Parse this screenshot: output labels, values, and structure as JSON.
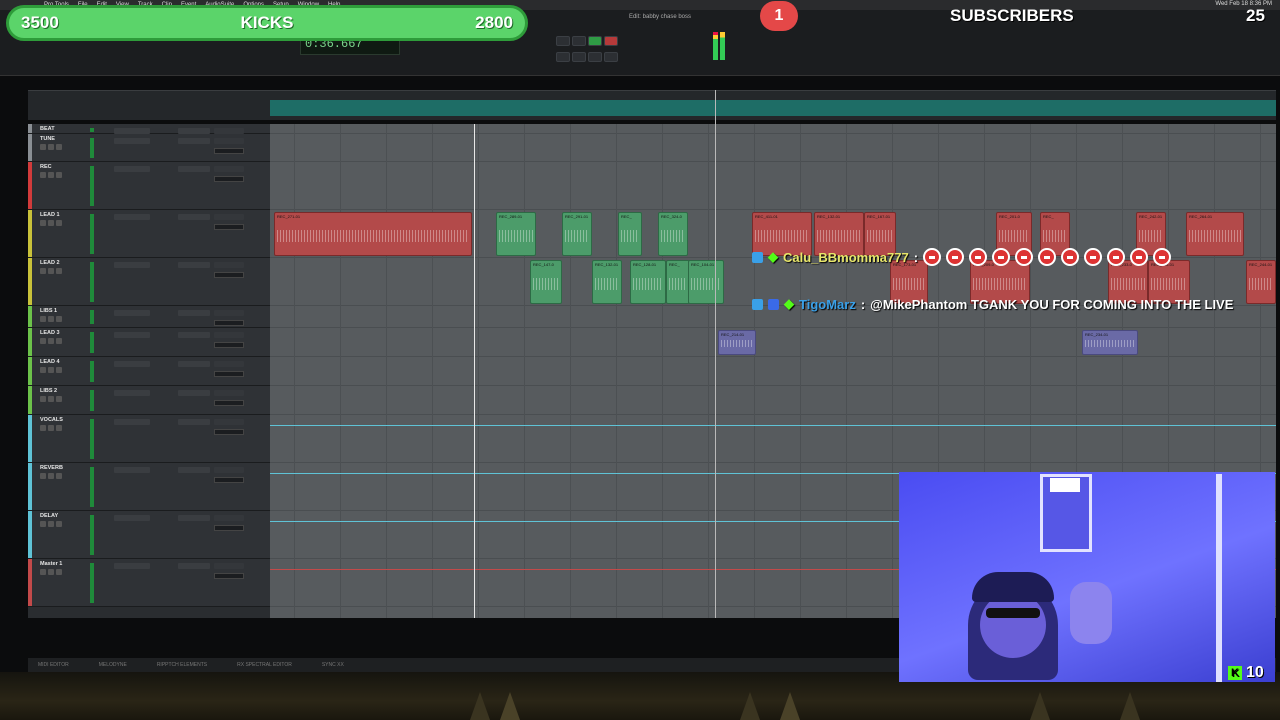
{
  "menubar": {
    "items": [
      "Pro Tools",
      "File",
      "Edit",
      "View",
      "Track",
      "Clip",
      "Event",
      "AudioSuite",
      "Options",
      "Setup",
      "Window",
      "Help"
    ],
    "clock": "Wed Feb 18 8:36 PM"
  },
  "toolbar": {
    "edit_window_title": "Edit: babby chase boss",
    "counter": "0:36.667"
  },
  "tracks": [
    {
      "name": "BEAT",
      "color": "#8a8f94",
      "h": 10
    },
    {
      "name": "TUNE",
      "color": "#8a8f94",
      "h": 28
    },
    {
      "name": "REC",
      "color": "#d23b3b",
      "h": 48
    },
    {
      "name": "LEAD 1",
      "color": "#c9c23a",
      "h": 48
    },
    {
      "name": "LEAD 2",
      "color": "#c9c23a",
      "h": 48
    },
    {
      "name": "LIBS 1",
      "color": "#6cc24a",
      "h": 22
    },
    {
      "name": "LEAD 3",
      "color": "#6cc24a",
      "h": 29
    },
    {
      "name": "LEAD 4",
      "color": "#6cc24a",
      "h": 29
    },
    {
      "name": "LIBS 2",
      "color": "#6cc24a",
      "h": 29
    },
    {
      "name": "VOCALS",
      "color": "#5fc3d6",
      "h": 48
    },
    {
      "name": "REVERB",
      "color": "#5fc3d6",
      "h": 48
    },
    {
      "name": "DELAY",
      "color": "#5fc3d6",
      "h": 48
    },
    {
      "name": "Master 1",
      "color": "#c34a4a",
      "h": 48
    }
  ],
  "clips": {
    "rec_row": [
      "REC_271-01",
      "REC_289-01",
      "REC_291-01",
      "REC_",
      "REC_324-0",
      "REC_411-01",
      "REC_132-01",
      "REC_167-01",
      "REC_201-0",
      "REC_",
      "REC_242-01",
      "REC_264-01"
    ],
    "lead1_row": [
      "REC_147-0",
      "REC_132-01",
      "REC_128-01",
      "REC_",
      "REC_104-01",
      "REC_173-01",
      "REC_209-0",
      "REC_233-0",
      "REC_245-01",
      "REC_244-01"
    ],
    "lead3_row": [
      "REC_214-01",
      "REC_234-01"
    ]
  },
  "dock": {
    "items": [
      "MIDI EDITOR",
      "MELODYNE",
      "RIPPTCH ELEMENTS",
      "RX SPECTRAL EDITOR",
      "SYNC XX"
    ]
  },
  "overlay": {
    "goal": {
      "left": "3500",
      "label": "KICKS",
      "right": "2800"
    },
    "subscribers": {
      "badge": "1",
      "label": "SUBSCRIBERS",
      "count": "25"
    },
    "chat": [
      {
        "user": "Calu_BBmomma777",
        "sep": ":",
        "message": ""
      },
      {
        "user": "TigoMarz",
        "sep": ":",
        "message": "@MikePhantom TGANK YOU FOR COMING INTO THE LIVE"
      }
    ],
    "viewers": "10",
    "colors": {
      "goal": "#5bd46a",
      "badge": "#e44848",
      "kick": "#53fc18",
      "cam": "#5a5cf0"
    }
  }
}
